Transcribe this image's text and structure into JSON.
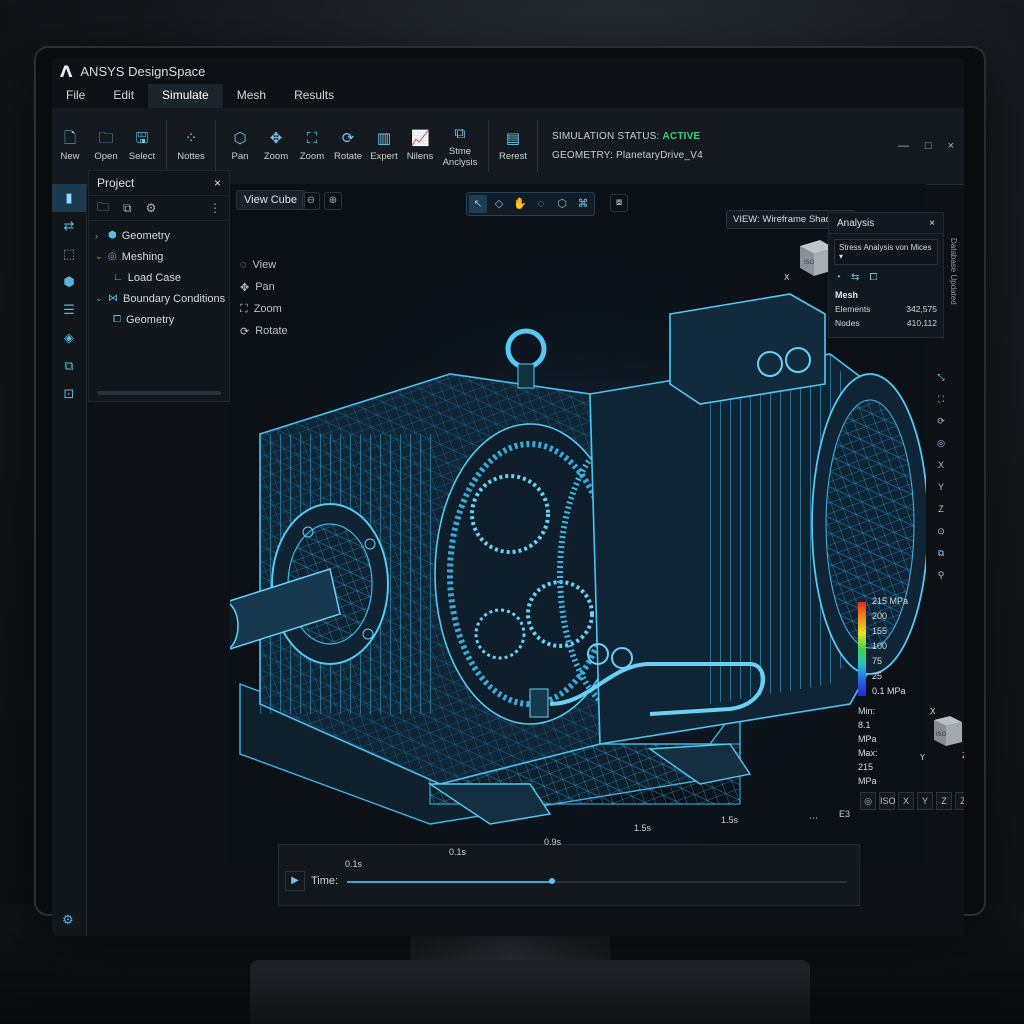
{
  "app": {
    "logo": "Λ",
    "title": "ANSYS DesignSpace"
  },
  "menu": [
    "File",
    "Edit",
    "Simulate",
    "Mesh",
    "Results"
  ],
  "window_controls": [
    "—",
    "□",
    "×"
  ],
  "toolbar": {
    "buttons": [
      {
        "label": "New",
        "icon": "file-icon",
        "glyph": "🗋"
      },
      {
        "label": "Open",
        "icon": "folder-icon",
        "glyph": "🗀"
      },
      {
        "label": "Select",
        "icon": "save-icon",
        "glyph": "🖫"
      },
      {
        "label": "Nottes",
        "icon": "nodes-icon",
        "glyph": "⁘"
      },
      {
        "label": "Pan",
        "icon": "cube-icon",
        "glyph": "⬡"
      },
      {
        "label": "Zoom",
        "icon": "move-icon",
        "glyph": "✥"
      },
      {
        "label": "Zoom",
        "icon": "fit-icon",
        "glyph": "⛶"
      },
      {
        "label": "Rotate",
        "icon": "rotate-icon",
        "glyph": "⟳"
      },
      {
        "label": "Expert",
        "icon": "bar-chart-icon",
        "glyph": "▥"
      },
      {
        "label": "Nilens",
        "icon": "line-chart-icon",
        "glyph": "📈"
      },
      {
        "label": "Stme Anclysis",
        "icon": "analysis-icon",
        "glyph": "⧉"
      },
      {
        "label": "Rerest",
        "icon": "report-icon",
        "glyph": "▤"
      }
    ],
    "status_label": "SIMULATION STATUS:",
    "status_value": "ACTIVE",
    "geometry_label": "GEOMETRY: PlanetaryDrive_V4"
  },
  "rail": [
    "project-icon",
    "transfer-icon",
    "select-icon",
    "box-icon",
    "sliders-icon",
    "layers-icon",
    "copy-icon",
    "info-icon"
  ],
  "project": {
    "title": "Project",
    "close": "×",
    "tools": [
      "🗀",
      "⧉",
      "⚙",
      "⋮"
    ],
    "tree": [
      {
        "label": "Geometry",
        "chev": "›",
        "icon": "⬢",
        "indent": 0
      },
      {
        "label": "Meshing",
        "chev": "⌄",
        "icon": "◎",
        "indent": 0
      },
      {
        "label": "Load Case",
        "chev": "",
        "icon": "∟",
        "indent": 1
      },
      {
        "label": "Boundary Conditions",
        "chev": "⌄",
        "icon": "⋈",
        "indent": 0
      },
      {
        "label": "Geometry",
        "chev": "",
        "icon": "⧠",
        "indent": 1
      }
    ]
  },
  "viewport": {
    "view_cube": "View Cube",
    "zoom": [
      "⊖",
      "⊕"
    ],
    "tools": [
      "↖",
      "◇",
      "✋",
      "◌",
      "⬡",
      "⌘"
    ],
    "snap": "⧇",
    "nav": [
      {
        "label": "View",
        "glyph": "◌"
      },
      {
        "label": "Pan",
        "glyph": "✥"
      },
      {
        "label": "Zoom",
        "glyph": "⛶"
      },
      {
        "label": "Rotate",
        "glyph": "⟳"
      }
    ],
    "view_mode": "VIEW: Wireframe Shaded",
    "cube_top": "ISO",
    "cube_axis": "X",
    "cube_axis_y": "Y"
  },
  "analysis": {
    "title": "Analysis",
    "close": "×",
    "selector": "Stress Analysis von Mices",
    "icons": [
      "◔",
      "⇆",
      "⧠"
    ],
    "mesh_title": "Mesh",
    "elements_label": "Elements",
    "elements_value": "342,575",
    "nodes_label": "Nodes",
    "nodes_value": "410,112",
    "side_tab": "Database Updated"
  },
  "side_tools": [
    "⤡",
    "⛶",
    "⟳",
    "◎",
    "X",
    "Y",
    "Z",
    "⊙",
    "⧉",
    "⚲"
  ],
  "legend": {
    "labels": [
      "215 MPa",
      "200",
      "155",
      "100",
      "75",
      "25",
      "0.1 MPa"
    ],
    "min": "Min: 8.1 MPa",
    "max": "Max: 215 MPa"
  },
  "triad": {
    "x": "X",
    "y": "Y",
    "z": "Z",
    "face": "ISO"
  },
  "view_buttons": [
    "◎",
    "ISO",
    "X",
    "Y",
    "Z",
    "Z"
  ],
  "timeline": {
    "play": "▶",
    "label": "Time:",
    "ticks": [
      "0.1s",
      "0.1s",
      "0.9s",
      "1.5s",
      "1.5s"
    ],
    "progress": 0.41,
    "end_icons": [
      "⋯",
      "E3"
    ]
  },
  "settings_icon": "⚙"
}
